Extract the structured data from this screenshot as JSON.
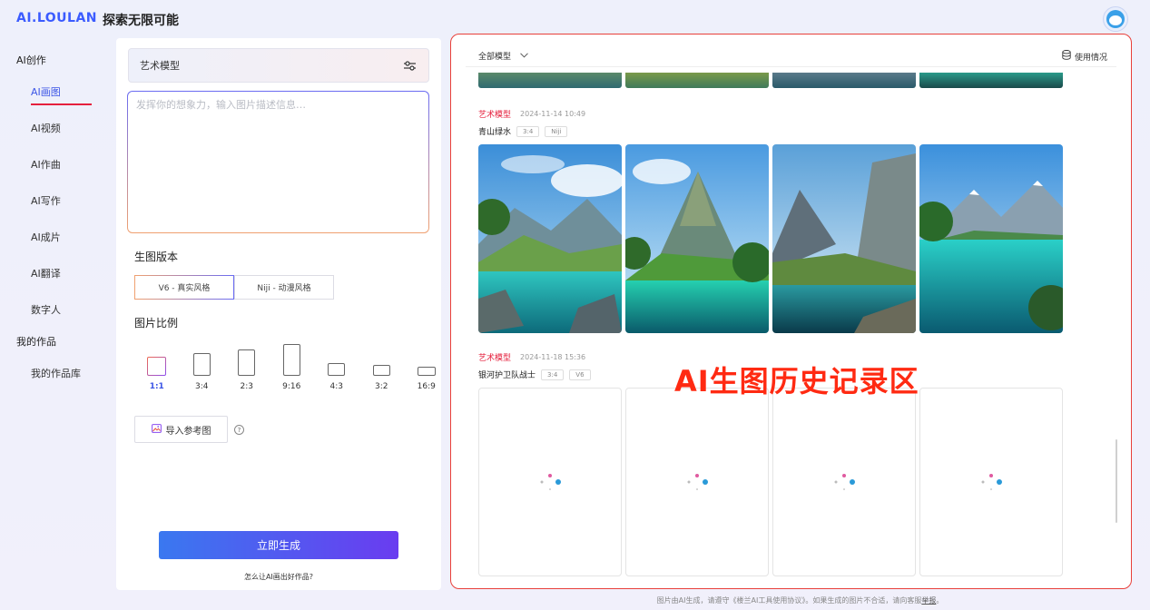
{
  "header": {
    "logo": "AI.LOULAN",
    "slogan": "探索无限可能"
  },
  "sidebar": {
    "create_section": "AI创作",
    "items": [
      {
        "label": "AI画图",
        "active": true
      },
      {
        "label": "AI视频"
      },
      {
        "label": "AI作曲"
      },
      {
        "label": "AI写作"
      },
      {
        "label": "AI成片"
      },
      {
        "label": "AI翻译"
      },
      {
        "label": "数字人"
      }
    ],
    "works_section": "我的作品",
    "works_items": [
      {
        "label": "我的作品库"
      }
    ]
  },
  "form": {
    "model_label": "艺术模型",
    "prompt_placeholder": "发挥你的想象力，输入图片描述信息…",
    "version_title": "生图版本",
    "versions": [
      {
        "label": "V6 - 真实风格",
        "active": true
      },
      {
        "label": "Niji - 动漫风格"
      }
    ],
    "ratio_title": "图片比例",
    "ratios": [
      {
        "label": "1:1",
        "active": true
      },
      {
        "label": "3:4"
      },
      {
        "label": "2:3"
      },
      {
        "label": "9:16"
      },
      {
        "label": "4:3"
      },
      {
        "label": "3:2"
      },
      {
        "label": "16:9"
      }
    ],
    "import_label": "导入参考图",
    "help_glyph": "?",
    "generate_label": "立即生成",
    "how_to_label": "怎么让AI画出好作品?"
  },
  "history": {
    "filter_label": "全部模型",
    "usage_label": "使用情况",
    "entries": [
      {
        "tag": "艺术模型",
        "time": "2024-11-14 10:49",
        "title": "青山绿水",
        "chips": [
          "3:4",
          "Niji"
        ],
        "status": "done"
      },
      {
        "tag": "艺术模型",
        "time": "2024-11-18 15:36",
        "title": "银河护卫队战士",
        "chips": [
          "3:4",
          "V6"
        ],
        "status": "generating"
      }
    ],
    "annotation": "AI生图历史记录区"
  },
  "footer": {
    "text": "图片由AI生成，请遵守《楼兰AI工具使用协议》。如果生成的图片不合适，请向客服",
    "link": "举报",
    "end": "。"
  },
  "colors": {
    "accent_blue": "#3b55e6",
    "tag_red": "#e5203d",
    "highlight_border": "#e8403a"
  }
}
